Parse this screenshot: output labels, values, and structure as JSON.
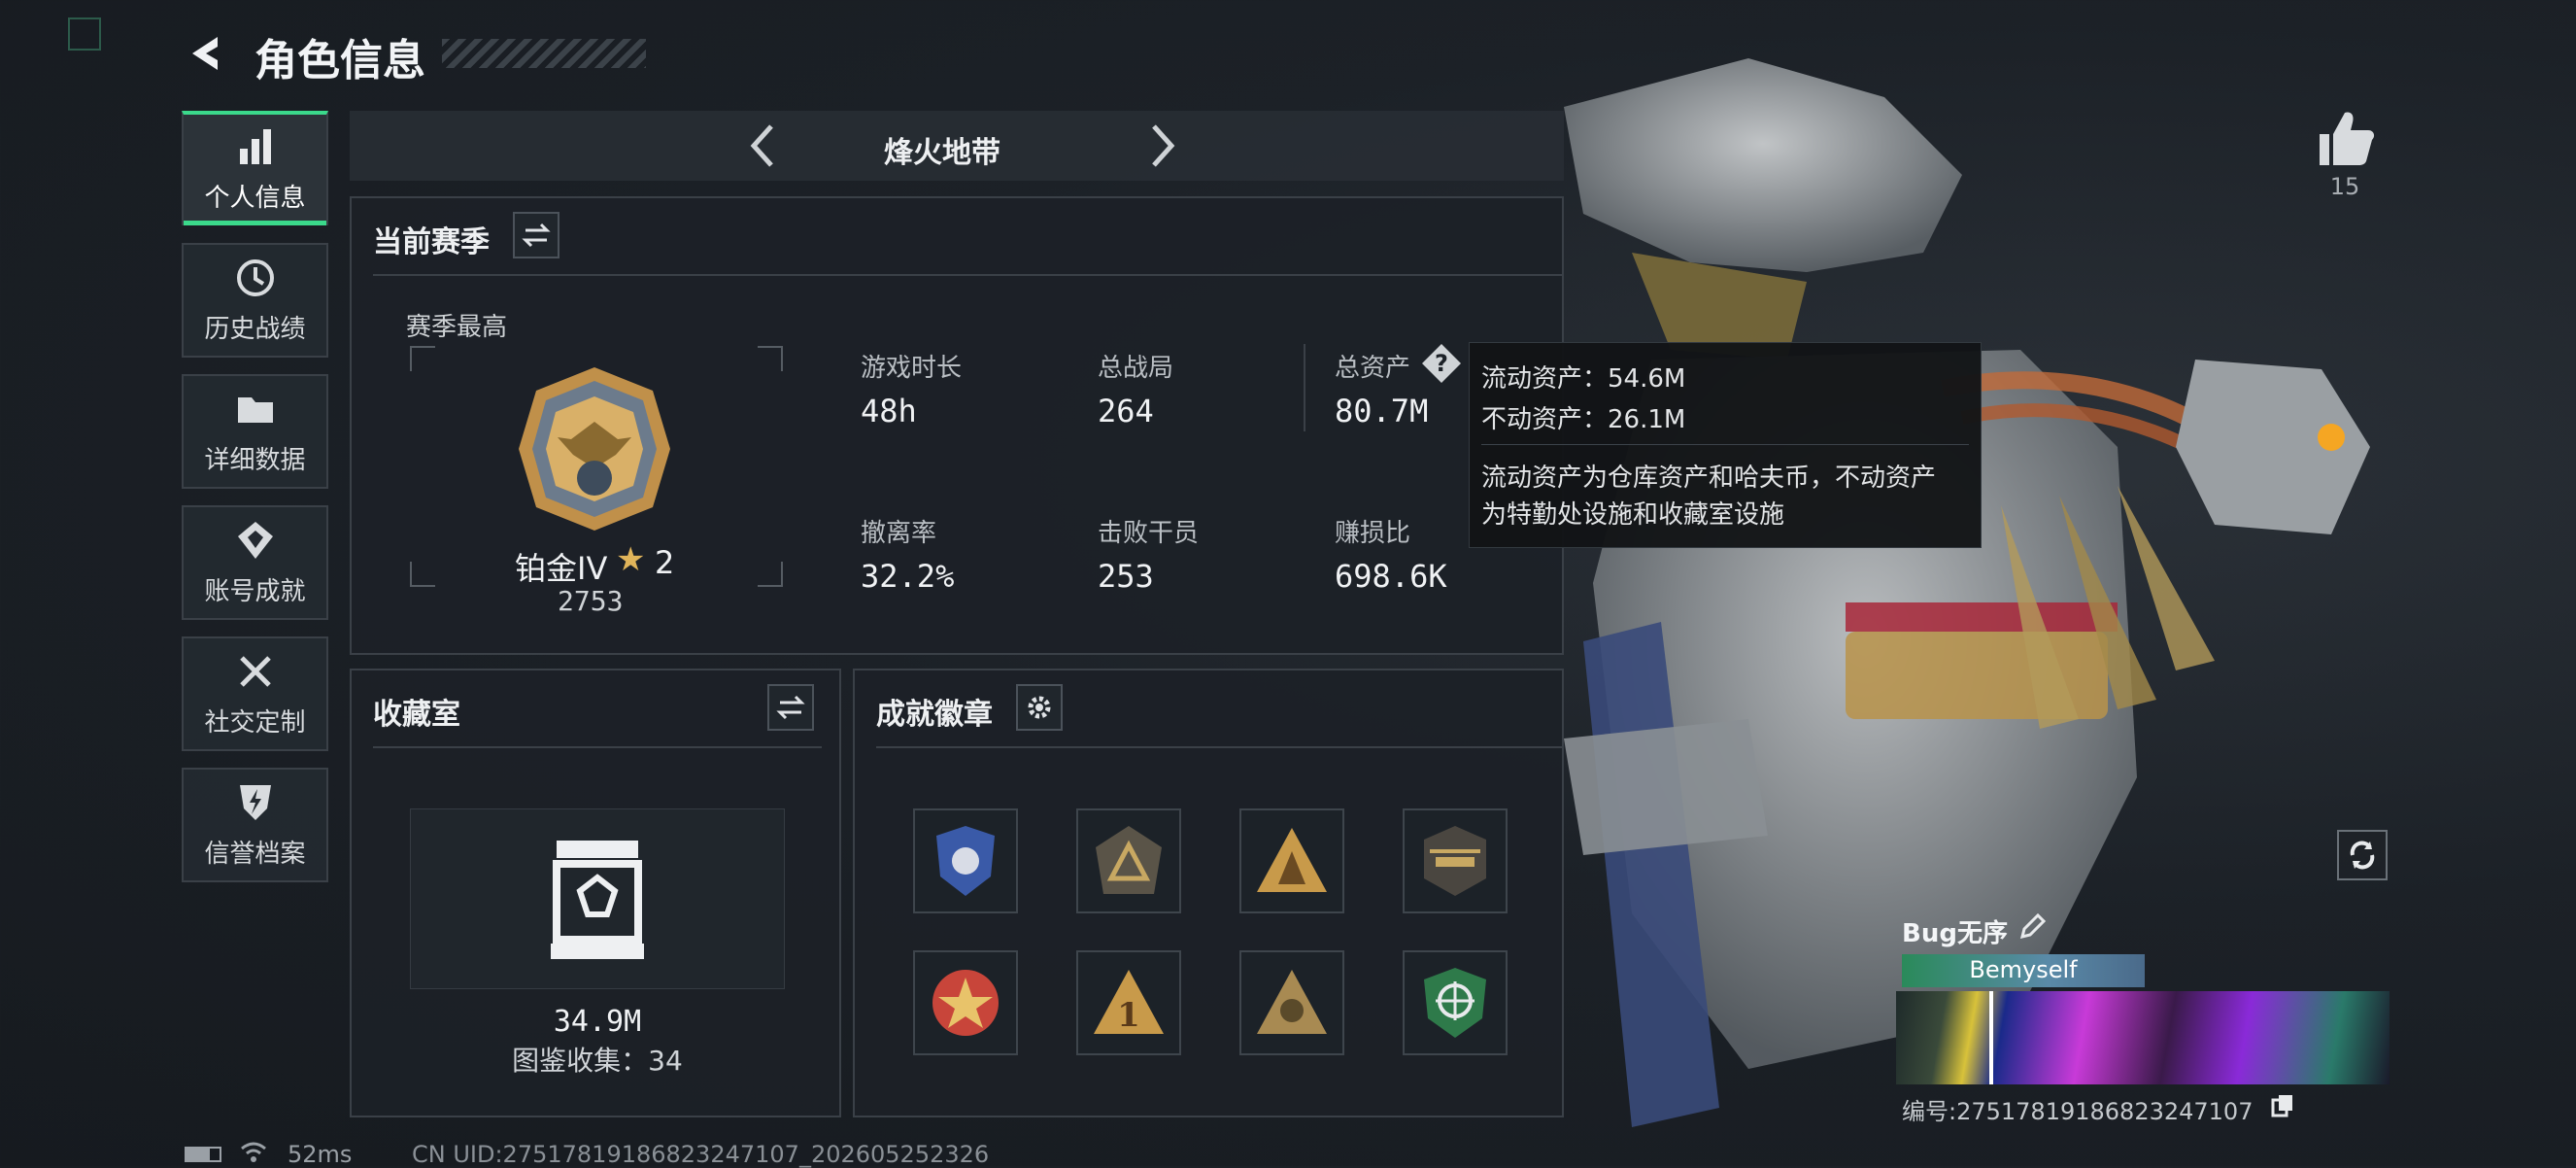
{
  "header": {
    "title": "角色信息"
  },
  "sidebar": {
    "items": [
      {
        "label": "个人信息",
        "icon": "bar-chart-icon",
        "active": true
      },
      {
        "label": "历史战绩",
        "icon": "history-icon"
      },
      {
        "label": "详细数据",
        "icon": "folder-icon"
      },
      {
        "label": "账号成就",
        "icon": "achievement-icon"
      },
      {
        "label": "社交定制",
        "icon": "tools-icon"
      },
      {
        "label": "信誉档案",
        "icon": "shield-bolt-icon"
      }
    ]
  },
  "mode_selector": {
    "label": "烽火地带"
  },
  "season": {
    "title": "当前赛季",
    "highest_label": "赛季最高",
    "rank_name": "铂金IV",
    "rank_stars": "2",
    "rank_score": "2753",
    "stats": [
      {
        "label": "游戏时长",
        "value": "48h"
      },
      {
        "label": "总战局",
        "value": "264"
      },
      {
        "label": "总资产",
        "value": "80.7M"
      },
      {
        "label": "撤离率",
        "value": "32.2%"
      },
      {
        "label": "击败干员",
        "value": "253"
      },
      {
        "label": "赚损比",
        "value": "698.6K"
      }
    ]
  },
  "tooltip": {
    "line1": "流动资产：54.6M",
    "line2": "不动资产：26.1M",
    "desc1": "流动资产为仓库资产和哈夫币，不动资产",
    "desc2": "为特勤处设施和收藏室设施"
  },
  "collection": {
    "title": "收藏室",
    "value": "34.9M",
    "count_text": "图鉴收集：34"
  },
  "achievements": {
    "title": "成就徽章",
    "badges": [
      "police-badge-icon",
      "triangle-badge-icon",
      "soldiers-badge-icon",
      "helicopter-badge-icon",
      "star-badge-icon",
      "number-one-badge-icon",
      "skull-badge-icon",
      "target-badge-icon"
    ]
  },
  "likes": {
    "count": "15"
  },
  "profile": {
    "name": "Bug无序",
    "tag": "Bemyself",
    "id_text": "编号:27517819186823247107"
  },
  "status_bar": {
    "ping": "52ms",
    "uid": "CN UID:27517819186823247107_202605252326"
  },
  "colors": {
    "accent": "#3bd98b",
    "gold": "#e0b45a"
  }
}
